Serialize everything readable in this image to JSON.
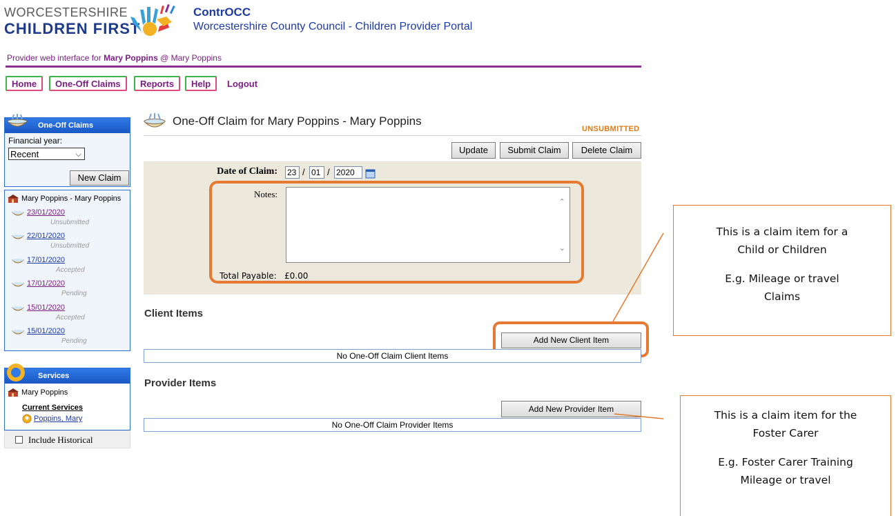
{
  "brand": {
    "logo_line1": "WORCESTERSHIRE",
    "logo_line2": "CHILDREN FIRST",
    "app_name": "ContrOCC",
    "app_subtitle": "Worcestershire County Council - Children Provider Portal"
  },
  "provider_line": {
    "prefix": "Provider web interface for ",
    "name": "Mary Poppins",
    "separator": " @ ",
    "org": "Mary Poppins"
  },
  "nav": {
    "home": "Home",
    "oneoff": "One-Off Claims",
    "reports": "Reports",
    "help": "Help",
    "logout": "Logout"
  },
  "sidebar": {
    "claims_panel": {
      "title": "One-Off Claims",
      "financial_year_label": "Financial year:",
      "financial_year_value": "Recent",
      "new_claim_label": "New Claim",
      "provider_name": "Mary Poppins - Mary Poppins",
      "claims": [
        {
          "date": "23/01/2020",
          "status": "Unsubmitted"
        },
        {
          "date": "22/01/2020",
          "status": "Unsubmitted"
        },
        {
          "date": "17/01/2020",
          "status": "Accepted"
        },
        {
          "date": "17/01/2020",
          "status": "Pending"
        },
        {
          "date": "15/01/2020",
          "status": "Accepted"
        },
        {
          "date": "15/01/2020",
          "status": "Pending"
        }
      ]
    },
    "services_panel": {
      "title": "Services",
      "provider_name": "Mary Poppins",
      "current_services_label": "Current Services",
      "service_link": "Poppins, Mary",
      "include_historical_label": "Include Historical"
    }
  },
  "main": {
    "title": "One-Off Claim for Mary Poppins - Mary Poppins",
    "status": "UNSUBMITTED",
    "buttons": {
      "update": "Update",
      "submit": "Submit Claim",
      "delete": "Delete Claim"
    },
    "form": {
      "date_label": "Date of Claim:",
      "date_day": "23",
      "date_month": "01",
      "date_year": "2020",
      "date_sep": "/",
      "notes_label": "Notes:",
      "total_label": "Total Payable:",
      "total_value": "£0.00"
    },
    "client_items": {
      "heading": "Client Items",
      "add_button": "Add New Client Item",
      "empty_text": "No One-Off Claim Client Items"
    },
    "provider_items": {
      "heading": "Provider Items",
      "add_button": "Add New Provider Item",
      "empty_text": "No One-Off Claim Provider Items"
    }
  },
  "callouts": {
    "client": {
      "line1": "This is a claim item for a",
      "line2": "Child or Children",
      "line3": "E.g. Mileage or travel",
      "line4": "Claims"
    },
    "provider": {
      "line1": "This is a claim item for the",
      "line2": "Foster Carer",
      "line3": "E.g. Foster Carer Training",
      "line4": "Mileage or travel"
    }
  },
  "colors": {
    "accent_purple": "#7b1e82",
    "link_blue": "#1e3aa6",
    "highlight_orange": "#e77a33",
    "panel_blue": "#2b6fd6"
  }
}
